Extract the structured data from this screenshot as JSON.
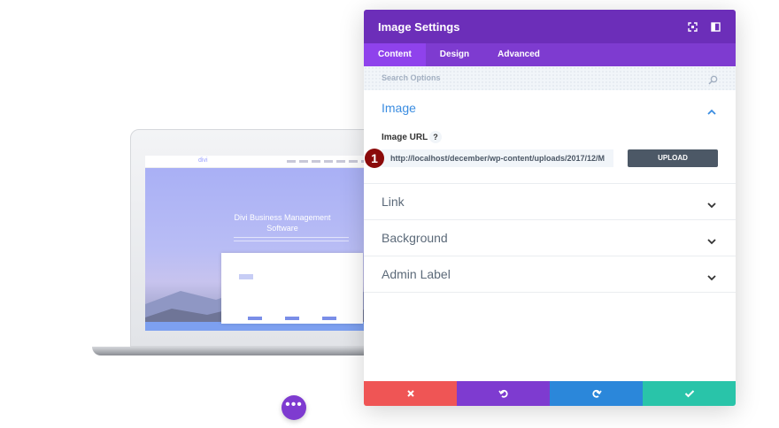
{
  "preview": {
    "hero_title": "Divi Business Management Software",
    "logo_text": "divi"
  },
  "panel": {
    "title": "Image Settings",
    "tabs": [
      {
        "label": "Content",
        "active": true
      },
      {
        "label": "Design",
        "active": false
      },
      {
        "label": "Advanced",
        "active": false
      }
    ],
    "search": {
      "placeholder": "Search Options"
    },
    "sections": {
      "image": {
        "title": "Image",
        "field_label": "Image URL",
        "help_symbol": "?",
        "url_value": "http://localhost/december/wp-content/uploads/2017/12/M",
        "upload_label": "UPLOAD"
      },
      "link": {
        "title": "Link"
      },
      "background": {
        "title": "Background"
      },
      "admin_label": {
        "title": "Admin Label"
      }
    },
    "step_badge": "1"
  },
  "colors": {
    "header": "#6c2eb9",
    "tabs_bar": "#7e3bd0",
    "active_tab": "#8f42ec",
    "accent_blue": "#3b8de1",
    "close": "#ef5555",
    "undo": "#7e3bd0",
    "redo": "#2b87da",
    "save": "#29c4a9"
  }
}
